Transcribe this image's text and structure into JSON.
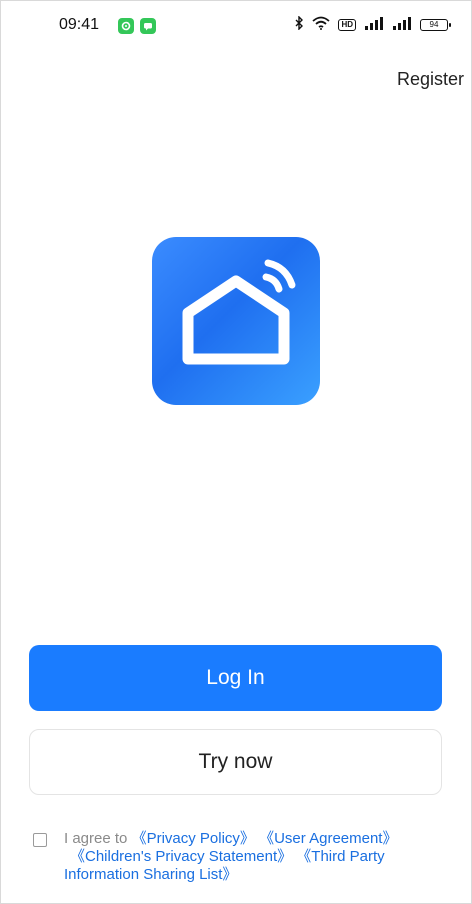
{
  "status_bar": {
    "time": "09:41",
    "hd_label": "HD",
    "battery": "94"
  },
  "header": {
    "register_label": "Register"
  },
  "actions": {
    "login_label": "Log In",
    "try_label": "Try now"
  },
  "agreement": {
    "prefix": "I agree to",
    "links": [
      "《Privacy Policy》",
      "《User Agreement》",
      "《Children's Privacy Statement》",
      "《Third Party Information Sharing List》"
    ]
  },
  "colors": {
    "primary": "#1a7cff",
    "link": "#1a6fe0",
    "notification": "#34c759"
  },
  "icons": [
    "notification-app-icon",
    "message-app-icon",
    "bluetooth-icon",
    "wifi-icon",
    "hd-icon",
    "signal-icon",
    "battery-icon",
    "smart-home-logo"
  ]
}
